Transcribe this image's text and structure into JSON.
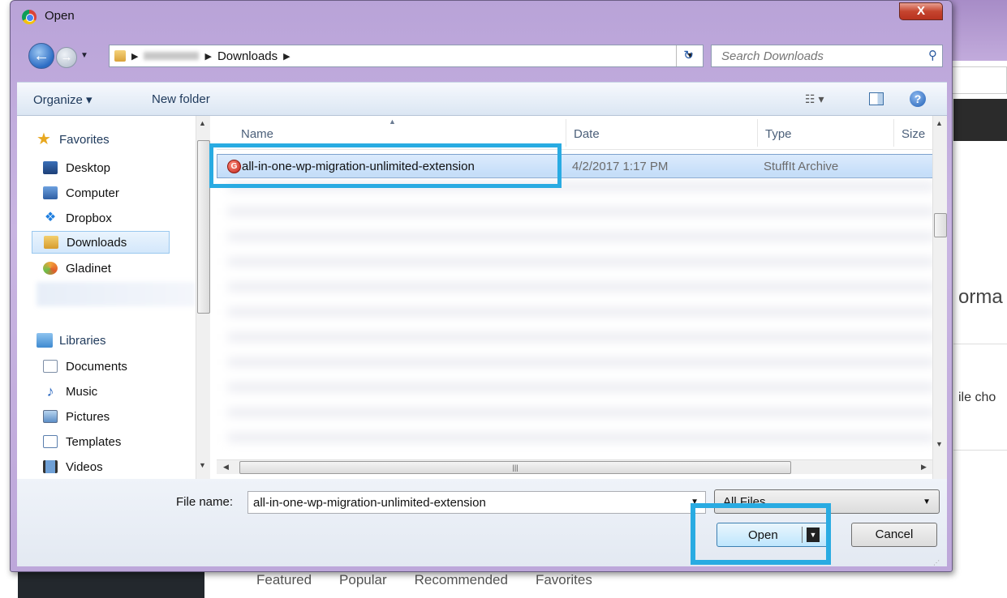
{
  "dialog": {
    "title": "Open",
    "close_label": "X"
  },
  "nav": {
    "breadcrumb_folder": "Downloads",
    "search_placeholder": "Search Downloads"
  },
  "toolbar": {
    "organize_label": "Organize ▾",
    "new_folder_label": "New folder"
  },
  "sidebar": {
    "favorites_label": "Favorites",
    "favorites": [
      {
        "label": "Desktop",
        "icon": "desktop-icon"
      },
      {
        "label": "Computer",
        "icon": "computer-icon"
      },
      {
        "label": "Dropbox",
        "icon": "dropbox-icon"
      },
      {
        "label": "Downloads",
        "icon": "downloads-folder-icon",
        "selected": true
      },
      {
        "label": "Gladinet",
        "icon": "gladinet-icon"
      }
    ],
    "libraries_label": "Libraries",
    "libraries": [
      {
        "label": "Documents",
        "icon": "documents-icon"
      },
      {
        "label": "Music",
        "icon": "music-icon"
      },
      {
        "label": "Pictures",
        "icon": "pictures-icon"
      },
      {
        "label": "Templates",
        "icon": "templates-icon"
      },
      {
        "label": "Videos",
        "icon": "videos-icon"
      }
    ]
  },
  "file_list": {
    "columns": [
      "Name",
      "Date",
      "Type",
      "Size"
    ],
    "rows": [
      {
        "name": "all-in-one-wp-migration-unlimited-extension",
        "date": "4/2/2017 1:17 PM",
        "type": "StuffIt Archive",
        "selected": true
      }
    ]
  },
  "bottom": {
    "file_name_label": "File name:",
    "file_name_value": "all-in-one-wp-migration-unlimited-extension",
    "filter_value": "All Files",
    "open_label": "Open",
    "cancel_label": "Cancel"
  },
  "background_page": {
    "heading_fragment": "orma",
    "text_fragment": "ile cho",
    "tabs": [
      "Featured",
      "Popular",
      "Recommended",
      "Favorites"
    ]
  },
  "colors": {
    "highlight_box": "#29abe2",
    "dialog_frame": "#c9b5e2"
  }
}
